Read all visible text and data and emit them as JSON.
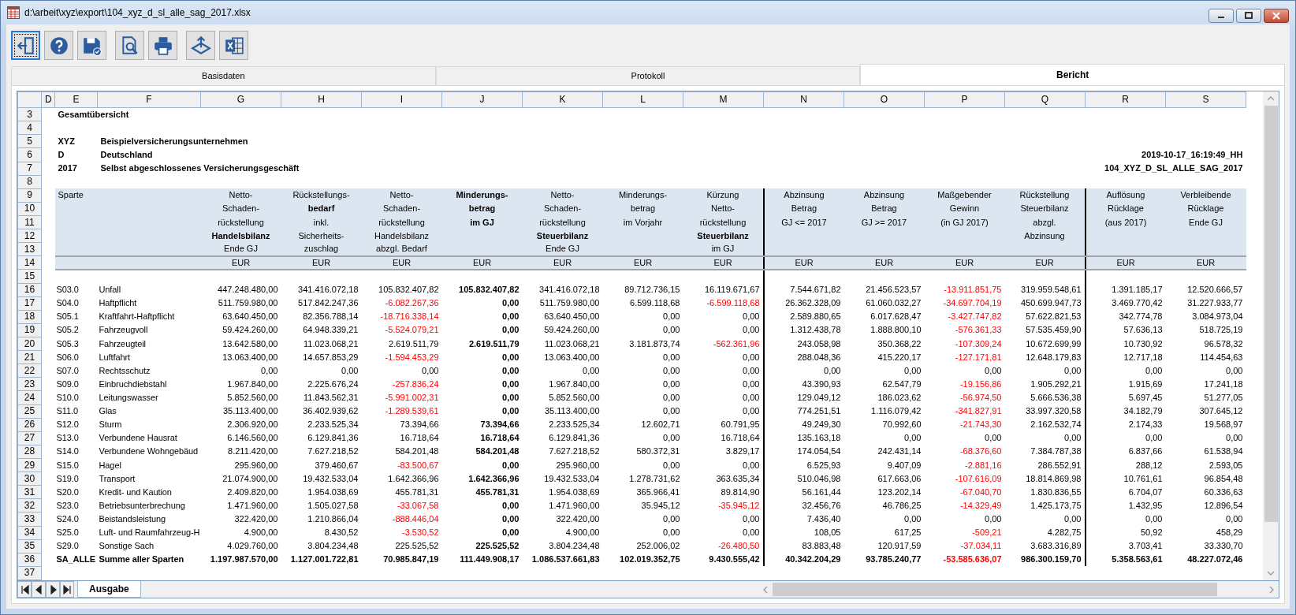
{
  "window": {
    "title": "d:\\arbeit\\xyz\\export\\104_xyz_d_sl_alle_sag_2017.xlsx"
  },
  "toolbar": [
    {
      "kind": "exit",
      "selected": true
    },
    {
      "kind": "help",
      "selected": false
    },
    {
      "kind": "save",
      "selected": false
    },
    {
      "kind": "preview",
      "selected": false
    },
    {
      "kind": "print",
      "selected": false
    },
    {
      "kind": "export",
      "selected": false
    },
    {
      "kind": "excel",
      "selected": false
    }
  ],
  "tabs": [
    {
      "label": "Basisdaten",
      "selected": false
    },
    {
      "label": "Protokoll",
      "selected": false
    },
    {
      "label": "Bericht",
      "selected": true
    }
  ],
  "sheet": {
    "column_letters": [
      "D",
      "E",
      "F",
      "G",
      "H",
      "I",
      "J",
      "K",
      "L",
      "M",
      "N",
      "O",
      "P",
      "Q",
      "R",
      "S"
    ],
    "row_numbers": [
      "3",
      "4",
      "5",
      "6",
      "7",
      "8",
      "9",
      "10",
      "11",
      "12",
      "13",
      "14",
      "15",
      "16",
      "17",
      "18",
      "19",
      "20",
      "21",
      "22",
      "23",
      "24",
      "25",
      "26",
      "27",
      "28",
      "29",
      "30",
      "31",
      "32",
      "33",
      "34",
      "35",
      "36",
      "37"
    ],
    "title": "Gesamtübersicht",
    "info": [
      {
        "code": "XYZ",
        "text": "Beispielversicherungsunternehmen"
      },
      {
        "code": "D",
        "text": "Deutschland",
        "right": "2019-10-17_16:19:49_HH"
      },
      {
        "code": "2017",
        "text": "Selbst abgeschlossenes Versicherungsgeschäft",
        "right": "104_XYZ_D_SL_ALLE_SAG_2017"
      }
    ],
    "header_label": "Sparte",
    "columns": [
      {
        "bold": false,
        "divider_after": false,
        "unit": "EUR",
        "lines": [
          {
            "text": "Netto-",
            "bold": false
          },
          {
            "text": "Schaden-",
            "bold": false
          },
          {
            "text": "rückstellung",
            "bold": false
          },
          {
            "text": "Handelsbilanz",
            "bold": true
          },
          {
            "text": "Ende GJ",
            "bold": false
          }
        ]
      },
      {
        "bold": false,
        "divider_after": false,
        "unit": "EUR",
        "lines": [
          {
            "text": "Rückstellungs-",
            "bold": false
          },
          {
            "text": "bedarf",
            "bold": true
          },
          {
            "text": "inkl.",
            "bold": false
          },
          {
            "text": "Sicherheits-",
            "bold": false
          },
          {
            "text": "zuschlag",
            "bold": false
          }
        ]
      },
      {
        "bold": false,
        "divider_after": false,
        "unit": "EUR",
        "lines": [
          {
            "text": "Netto-",
            "bold": false
          },
          {
            "text": "Schaden-",
            "bold": false
          },
          {
            "text": "rückstellung",
            "bold": false
          },
          {
            "text": "Handelsbilanz",
            "bold": false
          },
          {
            "text": "abzgl. Bedarf",
            "bold": false
          }
        ]
      },
      {
        "bold": true,
        "divider_after": false,
        "unit": "EUR",
        "lines": [
          {
            "text": "Minderungs-",
            "bold": true
          },
          {
            "text": "betrag",
            "bold": true
          },
          {
            "text": "im GJ",
            "bold": true
          }
        ]
      },
      {
        "bold": false,
        "divider_after": false,
        "unit": "EUR",
        "lines": [
          {
            "text": "Netto-",
            "bold": false
          },
          {
            "text": "Schaden-",
            "bold": false
          },
          {
            "text": "rückstellung",
            "bold": false
          },
          {
            "text": "Steuerbilanz",
            "bold": true
          },
          {
            "text": "Ende GJ",
            "bold": false
          }
        ]
      },
      {
        "bold": false,
        "divider_after": false,
        "unit": "EUR",
        "lines": [
          {
            "text": "Minderungs-",
            "bold": false
          },
          {
            "text": "betrag",
            "bold": false
          },
          {
            "text": "im Vorjahr",
            "bold": false
          }
        ]
      },
      {
        "bold": false,
        "divider_after": true,
        "unit": "EUR",
        "lines": [
          {
            "text": "Kürzung",
            "bold": false
          },
          {
            "text": "Netto-",
            "bold": false
          },
          {
            "text": "rückstellung",
            "bold": false
          },
          {
            "text": "Steuerbilanz",
            "bold": true
          },
          {
            "text": "im GJ",
            "bold": false
          }
        ]
      },
      {
        "bold": false,
        "divider_after": false,
        "unit": "EUR",
        "lines": [
          {
            "text": "Abzinsung",
            "bold": false
          },
          {
            "text": "Betrag",
            "bold": false
          },
          {
            "text": "GJ <= 2017",
            "bold": false
          }
        ]
      },
      {
        "bold": false,
        "divider_after": false,
        "unit": "EUR",
        "lines": [
          {
            "text": "Abzinsung",
            "bold": false
          },
          {
            "text": "Betrag",
            "bold": false
          },
          {
            "text": "GJ >= 2017",
            "bold": false
          }
        ]
      },
      {
        "bold": false,
        "divider_after": false,
        "unit": "EUR",
        "lines": [
          {
            "text": "Maßgebender",
            "bold": false
          },
          {
            "text": "Gewinn",
            "bold": false
          },
          {
            "text": "(in GJ 2017)",
            "bold": false
          }
        ]
      },
      {
        "bold": false,
        "divider_after": true,
        "unit": "EUR",
        "lines": [
          {
            "text": "Rückstellung",
            "bold": false
          },
          {
            "text": "Steuerbilanz",
            "bold": false
          },
          {
            "text": "abzgl.",
            "bold": false
          },
          {
            "text": "Abzinsung",
            "bold": false
          }
        ]
      },
      {
        "bold": false,
        "divider_after": false,
        "unit": "EUR",
        "lines": [
          {
            "text": "Auflösung",
            "bold": false
          },
          {
            "text": "Rücklage",
            "bold": false
          },
          {
            "text": "(aus 2017)",
            "bold": false
          }
        ]
      },
      {
        "bold": false,
        "divider_after": false,
        "unit": "EUR",
        "lines": [
          {
            "text": "Verbleibende",
            "bold": false
          },
          {
            "text": "Rücklage",
            "bold": false
          },
          {
            "text": "Ende GJ",
            "bold": false
          }
        ]
      }
    ],
    "rows": [
      {
        "code": "S03.0",
        "name": "Unfall",
        "total": false,
        "cells": [
          {
            "text": "447.248.480,00",
            "negative": false
          },
          {
            "text": "341.416.072,18",
            "negative": false
          },
          {
            "text": "105.832.407,82",
            "negative": false
          },
          {
            "text": "105.832.407,82",
            "negative": false
          },
          {
            "text": "341.416.072,18",
            "negative": false
          },
          {
            "text": "89.712.736,15",
            "negative": false
          },
          {
            "text": "16.119.671,67",
            "negative": false
          },
          {
            "text": "7.544.671,82",
            "negative": false
          },
          {
            "text": "21.456.523,57",
            "negative": false
          },
          {
            "text": "-13.911.851,75",
            "negative": true
          },
          {
            "text": "319.959.548,61",
            "negative": false
          },
          {
            "text": "1.391.185,17",
            "negative": false
          },
          {
            "text": "12.520.666,57",
            "negative": false
          }
        ]
      },
      {
        "code": "S04.0",
        "name": "Haftpflicht",
        "total": false,
        "cells": [
          {
            "text": "511.759.980,00",
            "negative": false
          },
          {
            "text": "517.842.247,36",
            "negative": false
          },
          {
            "text": "-6.082.267,36",
            "negative": true
          },
          {
            "text": "0,00",
            "negative": false
          },
          {
            "text": "511.759.980,00",
            "negative": false
          },
          {
            "text": "6.599.118,68",
            "negative": false
          },
          {
            "text": "-6.599.118,68",
            "negative": true
          },
          {
            "text": "26.362.328,09",
            "negative": false
          },
          {
            "text": "61.060.032,27",
            "negative": false
          },
          {
            "text": "-34.697.704,19",
            "negative": true
          },
          {
            "text": "450.699.947,73",
            "negative": false
          },
          {
            "text": "3.469.770,42",
            "negative": false
          },
          {
            "text": "31.227.933,77",
            "negative": false
          }
        ]
      },
      {
        "code": "S05.1",
        "name": "Kraftfahrt-Haftpflicht",
        "total": false,
        "cells": [
          {
            "text": "63.640.450,00",
            "negative": false
          },
          {
            "text": "82.356.788,14",
            "negative": false
          },
          {
            "text": "-18.716.338,14",
            "negative": true
          },
          {
            "text": "0,00",
            "negative": false
          },
          {
            "text": "63.640.450,00",
            "negative": false
          },
          {
            "text": "0,00",
            "negative": false
          },
          {
            "text": "0,00",
            "negative": false
          },
          {
            "text": "2.589.880,65",
            "negative": false
          },
          {
            "text": "6.017.628,47",
            "negative": false
          },
          {
            "text": "-3.427.747,82",
            "negative": true
          },
          {
            "text": "57.622.821,53",
            "negative": false
          },
          {
            "text": "342.774,78",
            "negative": false
          },
          {
            "text": "3.084.973,04",
            "negative": false
          }
        ]
      },
      {
        "code": "S05.2",
        "name": "Fahrzeugvoll",
        "total": false,
        "cells": [
          {
            "text": "59.424.260,00",
            "negative": false
          },
          {
            "text": "64.948.339,21",
            "negative": false
          },
          {
            "text": "-5.524.079,21",
            "negative": true
          },
          {
            "text": "0,00",
            "negative": false
          },
          {
            "text": "59.424.260,00",
            "negative": false
          },
          {
            "text": "0,00",
            "negative": false
          },
          {
            "text": "0,00",
            "negative": false
          },
          {
            "text": "1.312.438,78",
            "negative": false
          },
          {
            "text": "1.888.800,10",
            "negative": false
          },
          {
            "text": "-576.361,33",
            "negative": true
          },
          {
            "text": "57.535.459,90",
            "negative": false
          },
          {
            "text": "57.636,13",
            "negative": false
          },
          {
            "text": "518.725,19",
            "negative": false
          }
        ]
      },
      {
        "code": "S05.3",
        "name": "Fahrzeugteil",
        "total": false,
        "cells": [
          {
            "text": "13.642.580,00",
            "negative": false
          },
          {
            "text": "11.023.068,21",
            "negative": false
          },
          {
            "text": "2.619.511,79",
            "negative": false
          },
          {
            "text": "2.619.511,79",
            "negative": false
          },
          {
            "text": "11.023.068,21",
            "negative": false
          },
          {
            "text": "3.181.873,74",
            "negative": false
          },
          {
            "text": "-562.361,96",
            "negative": true
          },
          {
            "text": "243.058,98",
            "negative": false
          },
          {
            "text": "350.368,22",
            "negative": false
          },
          {
            "text": "-107.309,24",
            "negative": true
          },
          {
            "text": "10.672.699,99",
            "negative": false
          },
          {
            "text": "10.730,92",
            "negative": false
          },
          {
            "text": "96.578,32",
            "negative": false
          }
        ]
      },
      {
        "code": "S06.0",
        "name": "Luftfahrt",
        "total": false,
        "cells": [
          {
            "text": "13.063.400,00",
            "negative": false
          },
          {
            "text": "14.657.853,29",
            "negative": false
          },
          {
            "text": "-1.594.453,29",
            "negative": true
          },
          {
            "text": "0,00",
            "negative": false
          },
          {
            "text": "13.063.400,00",
            "negative": false
          },
          {
            "text": "0,00",
            "negative": false
          },
          {
            "text": "0,00",
            "negative": false
          },
          {
            "text": "288.048,36",
            "negative": false
          },
          {
            "text": "415.220,17",
            "negative": false
          },
          {
            "text": "-127.171,81",
            "negative": true
          },
          {
            "text": "12.648.179,83",
            "negative": false
          },
          {
            "text": "12.717,18",
            "negative": false
          },
          {
            "text": "114.454,63",
            "negative": false
          }
        ]
      },
      {
        "code": "S07.0",
        "name": "Rechtsschutz",
        "total": false,
        "cells": [
          {
            "text": "0,00",
            "negative": false
          },
          {
            "text": "0,00",
            "negative": false
          },
          {
            "text": "0,00",
            "negative": false
          },
          {
            "text": "0,00",
            "negative": false
          },
          {
            "text": "0,00",
            "negative": false
          },
          {
            "text": "0,00",
            "negative": false
          },
          {
            "text": "0,00",
            "negative": false
          },
          {
            "text": "0,00",
            "negative": false
          },
          {
            "text": "0,00",
            "negative": false
          },
          {
            "text": "0,00",
            "negative": false
          },
          {
            "text": "0,00",
            "negative": false
          },
          {
            "text": "0,00",
            "negative": false
          },
          {
            "text": "0,00",
            "negative": false
          }
        ]
      },
      {
        "code": "S09.0",
        "name": "Einbruchdiebstahl",
        "total": false,
        "cells": [
          {
            "text": "1.967.840,00",
            "negative": false
          },
          {
            "text": "2.225.676,24",
            "negative": false
          },
          {
            "text": "-257.836,24",
            "negative": true
          },
          {
            "text": "0,00",
            "negative": false
          },
          {
            "text": "1.967.840,00",
            "negative": false
          },
          {
            "text": "0,00",
            "negative": false
          },
          {
            "text": "0,00",
            "negative": false
          },
          {
            "text": "43.390,93",
            "negative": false
          },
          {
            "text": "62.547,79",
            "negative": false
          },
          {
            "text": "-19.156,86",
            "negative": true
          },
          {
            "text": "1.905.292,21",
            "negative": false
          },
          {
            "text": "1.915,69",
            "negative": false
          },
          {
            "text": "17.241,18",
            "negative": false
          }
        ]
      },
      {
        "code": "S10.0",
        "name": "Leitungswasser",
        "total": false,
        "cells": [
          {
            "text": "5.852.560,00",
            "negative": false
          },
          {
            "text": "11.843.562,31",
            "negative": false
          },
          {
            "text": "-5.991.002,31",
            "negative": true
          },
          {
            "text": "0,00",
            "negative": false
          },
          {
            "text": "5.852.560,00",
            "negative": false
          },
          {
            "text": "0,00",
            "negative": false
          },
          {
            "text": "0,00",
            "negative": false
          },
          {
            "text": "129.049,12",
            "negative": false
          },
          {
            "text": "186.023,62",
            "negative": false
          },
          {
            "text": "-56.974,50",
            "negative": true
          },
          {
            "text": "5.666.536,38",
            "negative": false
          },
          {
            "text": "5.697,45",
            "negative": false
          },
          {
            "text": "51.277,05",
            "negative": false
          }
        ]
      },
      {
        "code": "S11.0",
        "name": "Glas",
        "total": false,
        "cells": [
          {
            "text": "35.113.400,00",
            "negative": false
          },
          {
            "text": "36.402.939,62",
            "negative": false
          },
          {
            "text": "-1.289.539,61",
            "negative": true
          },
          {
            "text": "0,00",
            "negative": false
          },
          {
            "text": "35.113.400,00",
            "negative": false
          },
          {
            "text": "0,00",
            "negative": false
          },
          {
            "text": "0,00",
            "negative": false
          },
          {
            "text": "774.251,51",
            "negative": false
          },
          {
            "text": "1.116.079,42",
            "negative": false
          },
          {
            "text": "-341.827,91",
            "negative": true
          },
          {
            "text": "33.997.320,58",
            "negative": false
          },
          {
            "text": "34.182,79",
            "negative": false
          },
          {
            "text": "307.645,12",
            "negative": false
          }
        ]
      },
      {
        "code": "S12.0",
        "name": "Sturm",
        "total": false,
        "cells": [
          {
            "text": "2.306.920,00",
            "negative": false
          },
          {
            "text": "2.233.525,34",
            "negative": false
          },
          {
            "text": "73.394,66",
            "negative": false
          },
          {
            "text": "73.394,66",
            "negative": false
          },
          {
            "text": "2.233.525,34",
            "negative": false
          },
          {
            "text": "12.602,71",
            "negative": false
          },
          {
            "text": "60.791,95",
            "negative": false
          },
          {
            "text": "49.249,30",
            "negative": false
          },
          {
            "text": "70.992,60",
            "negative": false
          },
          {
            "text": "-21.743,30",
            "negative": true
          },
          {
            "text": "2.162.532,74",
            "negative": false
          },
          {
            "text": "2.174,33",
            "negative": false
          },
          {
            "text": "19.568,97",
            "negative": false
          }
        ]
      },
      {
        "code": "S13.0",
        "name": "Verbundene Hausrat",
        "total": false,
        "cells": [
          {
            "text": "6.146.560,00",
            "negative": false
          },
          {
            "text": "6.129.841,36",
            "negative": false
          },
          {
            "text": "16.718,64",
            "negative": false
          },
          {
            "text": "16.718,64",
            "negative": false
          },
          {
            "text": "6.129.841,36",
            "negative": false
          },
          {
            "text": "0,00",
            "negative": false
          },
          {
            "text": "16.718,64",
            "negative": false
          },
          {
            "text": "135.163,18",
            "negative": false
          },
          {
            "text": "0,00",
            "negative": false
          },
          {
            "text": "0,00",
            "negative": false
          },
          {
            "text": "0,00",
            "negative": false
          },
          {
            "text": "0,00",
            "negative": false
          },
          {
            "text": "0,00",
            "negative": false
          }
        ]
      },
      {
        "code": "S14.0",
        "name": "Verbundene Wohngebäud",
        "total": false,
        "cells": [
          {
            "text": "8.211.420,00",
            "negative": false
          },
          {
            "text": "7.627.218,52",
            "negative": false
          },
          {
            "text": "584.201,48",
            "negative": false
          },
          {
            "text": "584.201,48",
            "negative": false
          },
          {
            "text": "7.627.218,52",
            "negative": false
          },
          {
            "text": "580.372,31",
            "negative": false
          },
          {
            "text": "3.829,17",
            "negative": false
          },
          {
            "text": "174.054,54",
            "negative": false
          },
          {
            "text": "242.431,14",
            "negative": false
          },
          {
            "text": "-68.376,60",
            "negative": true
          },
          {
            "text": "7.384.787,38",
            "negative": false
          },
          {
            "text": "6.837,66",
            "negative": false
          },
          {
            "text": "61.538,94",
            "negative": false
          }
        ]
      },
      {
        "code": "S15.0",
        "name": "Hagel",
        "total": false,
        "cells": [
          {
            "text": "295.960,00",
            "negative": false
          },
          {
            "text": "379.460,67",
            "negative": false
          },
          {
            "text": "-83.500,67",
            "negative": true
          },
          {
            "text": "0,00",
            "negative": false
          },
          {
            "text": "295.960,00",
            "negative": false
          },
          {
            "text": "0,00",
            "negative": false
          },
          {
            "text": "0,00",
            "negative": false
          },
          {
            "text": "6.525,93",
            "negative": false
          },
          {
            "text": "9.407,09",
            "negative": false
          },
          {
            "text": "-2.881,16",
            "negative": true
          },
          {
            "text": "286.552,91",
            "negative": false
          },
          {
            "text": "288,12",
            "negative": false
          },
          {
            "text": "2.593,05",
            "negative": false
          }
        ]
      },
      {
        "code": "S19.0",
        "name": "Transport",
        "total": false,
        "cells": [
          {
            "text": "21.074.900,00",
            "negative": false
          },
          {
            "text": "19.432.533,04",
            "negative": false
          },
          {
            "text": "1.642.366,96",
            "negative": false
          },
          {
            "text": "1.642.366,96",
            "negative": false
          },
          {
            "text": "19.432.533,04",
            "negative": false
          },
          {
            "text": "1.278.731,62",
            "negative": false
          },
          {
            "text": "363.635,34",
            "negative": false
          },
          {
            "text": "510.046,98",
            "negative": false
          },
          {
            "text": "617.663,06",
            "negative": false
          },
          {
            "text": "-107.616,09",
            "negative": true
          },
          {
            "text": "18.814.869,98",
            "negative": false
          },
          {
            "text": "10.761,61",
            "negative": false
          },
          {
            "text": "96.854,48",
            "negative": false
          }
        ]
      },
      {
        "code": "S20.0",
        "name": "Kredit- und Kaution",
        "total": false,
        "cells": [
          {
            "text": "2.409.820,00",
            "negative": false
          },
          {
            "text": "1.954.038,69",
            "negative": false
          },
          {
            "text": "455.781,31",
            "negative": false
          },
          {
            "text": "455.781,31",
            "negative": false
          },
          {
            "text": "1.954.038,69",
            "negative": false
          },
          {
            "text": "365.966,41",
            "negative": false
          },
          {
            "text": "89.814,90",
            "negative": false
          },
          {
            "text": "56.161,44",
            "negative": false
          },
          {
            "text": "123.202,14",
            "negative": false
          },
          {
            "text": "-67.040,70",
            "negative": true
          },
          {
            "text": "1.830.836,55",
            "negative": false
          },
          {
            "text": "6.704,07",
            "negative": false
          },
          {
            "text": "60.336,63",
            "negative": false
          }
        ]
      },
      {
        "code": "S23.0",
        "name": "Betriebsunterbrechung",
        "total": false,
        "cells": [
          {
            "text": "1.471.960,00",
            "negative": false
          },
          {
            "text": "1.505.027,58",
            "negative": false
          },
          {
            "text": "-33.067,58",
            "negative": true
          },
          {
            "text": "0,00",
            "negative": false
          },
          {
            "text": "1.471.960,00",
            "negative": false
          },
          {
            "text": "35.945,12",
            "negative": false
          },
          {
            "text": "-35.945,12",
            "negative": true
          },
          {
            "text": "32.456,76",
            "negative": false
          },
          {
            "text": "46.786,25",
            "negative": false
          },
          {
            "text": "-14.329,49",
            "negative": true
          },
          {
            "text": "1.425.173,75",
            "negative": false
          },
          {
            "text": "1.432,95",
            "negative": false
          },
          {
            "text": "12.896,54",
            "negative": false
          }
        ]
      },
      {
        "code": "S24.0",
        "name": "Beistandsleistung",
        "total": false,
        "cells": [
          {
            "text": "322.420,00",
            "negative": false
          },
          {
            "text": "1.210.866,04",
            "negative": false
          },
          {
            "text": "-888.446,04",
            "negative": true
          },
          {
            "text": "0,00",
            "negative": false
          },
          {
            "text": "322.420,00",
            "negative": false
          },
          {
            "text": "0,00",
            "negative": false
          },
          {
            "text": "0,00",
            "negative": false
          },
          {
            "text": "7.436,40",
            "negative": false
          },
          {
            "text": "0,00",
            "negative": false
          },
          {
            "text": "0,00",
            "negative": false
          },
          {
            "text": "0,00",
            "negative": false
          },
          {
            "text": "0,00",
            "negative": false
          },
          {
            "text": "0,00",
            "negative": false
          }
        ]
      },
      {
        "code": "S25.0",
        "name": "Luft- und Raumfahrzeug-H",
        "total": false,
        "cells": [
          {
            "text": "4.900,00",
            "negative": false
          },
          {
            "text": "8.430,52",
            "negative": false
          },
          {
            "text": "-3.530,52",
            "negative": true
          },
          {
            "text": "0,00",
            "negative": false
          },
          {
            "text": "4.900,00",
            "negative": false
          },
          {
            "text": "0,00",
            "negative": false
          },
          {
            "text": "0,00",
            "negative": false
          },
          {
            "text": "108,05",
            "negative": false
          },
          {
            "text": "617,25",
            "negative": false
          },
          {
            "text": "-509,21",
            "negative": true
          },
          {
            "text": "4.282,75",
            "negative": false
          },
          {
            "text": "50,92",
            "negative": false
          },
          {
            "text": "458,29",
            "negative": false
          }
        ]
      },
      {
        "code": "S29.0",
        "name": "Sonstige Sach",
        "total": false,
        "cells": [
          {
            "text": "4.029.760,00",
            "negative": false
          },
          {
            "text": "3.804.234,48",
            "negative": false
          },
          {
            "text": "225.525,52",
            "negative": false
          },
          {
            "text": "225.525,52",
            "negative": false
          },
          {
            "text": "3.804.234,48",
            "negative": false
          },
          {
            "text": "252.006,02",
            "negative": false
          },
          {
            "text": "-26.480,50",
            "negative": true
          },
          {
            "text": "83.883,48",
            "negative": false
          },
          {
            "text": "120.917,59",
            "negative": false
          },
          {
            "text": "-37.034,11",
            "negative": true
          },
          {
            "text": "3.683.316,89",
            "negative": false
          },
          {
            "text": "3.703,41",
            "negative": false
          },
          {
            "text": "33.330,70",
            "negative": false
          }
        ]
      },
      {
        "code": "SA_ALLE",
        "name": "Summe aller Sparten",
        "total": true,
        "cells": [
          {
            "text": "1.197.987.570,00",
            "negative": false
          },
          {
            "text": "1.127.001.722,81",
            "negative": false
          },
          {
            "text": "70.985.847,19",
            "negative": false
          },
          {
            "text": "111.449.908,17",
            "negative": false
          },
          {
            "text": "1.086.537.661,83",
            "negative": false
          },
          {
            "text": "102.019.352,75",
            "negative": false
          },
          {
            "text": "9.430.555,42",
            "negative": false
          },
          {
            "text": "40.342.204,29",
            "negative": false
          },
          {
            "text": "93.785.240,77",
            "negative": false
          },
          {
            "text": "-53.585.636,07",
            "negative": true
          },
          {
            "text": "986.300.159,70",
            "negative": false
          },
          {
            "text": "5.358.563,61",
            "negative": false
          },
          {
            "text": "48.227.072,46",
            "negative": false
          }
        ]
      }
    ],
    "sheet_tabs": [
      {
        "label": "Ausgabe",
        "selected": true
      }
    ]
  }
}
